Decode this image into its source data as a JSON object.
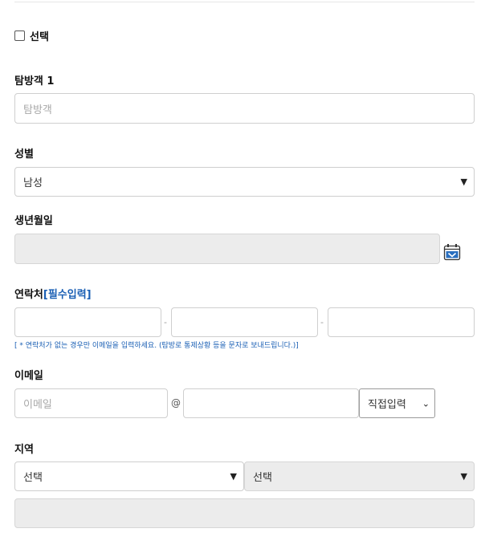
{
  "select_label": "선택",
  "traveler": {
    "label": "탐방객 1",
    "placeholder": "탐방객"
  },
  "gender": {
    "label": "성별",
    "selected": "남성"
  },
  "birthdate": {
    "label": "생년월일",
    "value": ""
  },
  "contact": {
    "label": "연락처",
    "required_tag": "[필수입력]",
    "dash": "-",
    "note": "[ * 연락처가 없는 경우만 이메일을 입력하세요. (탐방로 통제상황 등을 문자로 보내드립니다.)]"
  },
  "email": {
    "label": "이메일",
    "placeholder": "이메일",
    "at": "@",
    "domain_select": "직접입력"
  },
  "region": {
    "label": "지역",
    "select1": "선택",
    "select2": "선택",
    "detail_value": ""
  }
}
